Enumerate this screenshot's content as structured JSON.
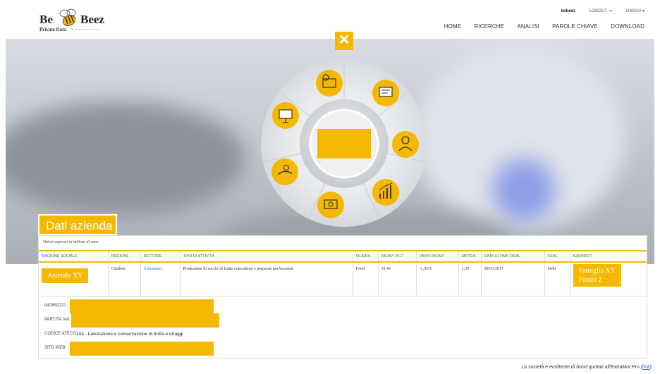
{
  "logo": {
    "word1": "Be",
    "word2": "Beez",
    "subtitle": "Private Data"
  },
  "topbar": {
    "user": "bebeez",
    "logout": "LOGOUT",
    "lingua": "LINGUA ▾"
  },
  "nav": [
    "HOME",
    "RICERCHE",
    "ANALISI",
    "PAROLE CHIAVE",
    "DOWNLOAD"
  ],
  "wheel": {
    "close": "✕",
    "accent": "#f5b800",
    "items": [
      "gear-document-icon",
      "news-icon",
      "manager-icon",
      "chart-icon",
      "money-icon",
      "hand-coin-icon",
      "presentation-icon"
    ]
  },
  "dati": {
    "title": "Dati azienda",
    "note": "Valori espressi in milioni di euro.",
    "columns": [
      "RAGIONE SOCIALE",
      "REGIONE",
      "SETTORE",
      "TIPO DI ATTIVITÀ",
      "FILIERA",
      "RICAVI 2017",
      "VAR% RICAVI",
      "EBITDA",
      "DATA ULTIMO DEAL",
      "DEAL",
      "AZIONISTI"
    ],
    "row": {
      "ragione_sociale": "Azienda XY",
      "regione": "Calabria",
      "settore": "Alimentare",
      "tipo_attivita": "Produzione di succhi di frutta concentrati e preparati per bevande",
      "filiera": "Food",
      "ricavi": "19,40",
      "var_ricavi": "-1,02%",
      "ebitda": "1,30",
      "data_deal": "09/03/2017",
      "deal": "Debt",
      "azionisti1": "Famiglia XY",
      "azionisti2": "Fondo Z"
    },
    "info": {
      "indirizzo": "INDIRIZZO:",
      "partita_iva": "PARTITA IVA:",
      "ateco_label": "CODICE ATECO:",
      "ateco_value": "103 - Lavorazione e conservazione di frutta e ortaggi",
      "sito": "SITO WEB:"
    }
  },
  "footer": {
    "text": "La società è emittente di bond quotati all'ExtraMot Pro (",
    "link": "link",
    "close": ")"
  }
}
